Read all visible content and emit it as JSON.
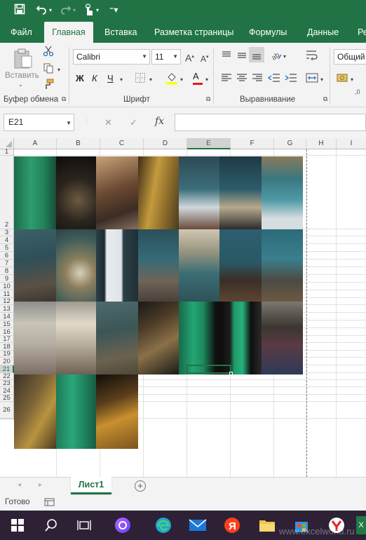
{
  "quick_access": {
    "save_icon": "save-icon",
    "undo_icon": "undo-icon",
    "redo_icon": "redo-icon",
    "touch_icon": "touch-mode-icon",
    "customize_icon": "customize-icon"
  },
  "tabs": [
    {
      "label": "Файл"
    },
    {
      "label": "Главная"
    },
    {
      "label": "Вставка"
    },
    {
      "label": "Разметка страницы"
    },
    {
      "label": "Формулы"
    },
    {
      "label": "Данные"
    },
    {
      "label": "Ре"
    }
  ],
  "ribbon": {
    "paste_label": "Вставить",
    "clipboard_group": "Буфер обмена",
    "font_name": "Calibri",
    "font_size": "11",
    "font_group": "Шрифт",
    "bold": "Ж",
    "italic": "К",
    "underline": "Ч",
    "grow_font": "A",
    "shrink_font": "A",
    "font_color_letter": "A",
    "alignment_group": "Выравнивание",
    "number_format": "Общий"
  },
  "formula_bar": {
    "name_box": "E21",
    "fx": "fx",
    "cancel": "✕",
    "enter": "✓",
    "formula": ""
  },
  "columns": [
    "A",
    "B",
    "C",
    "D",
    "E",
    "F",
    "G",
    "H",
    "I"
  ],
  "rows": [
    "1",
    "2",
    "3",
    "4",
    "5",
    "6",
    "7",
    "8",
    "9",
    "10",
    "11",
    "12",
    "13",
    "14",
    "15",
    "16",
    "17",
    "18",
    "19",
    "20",
    "21",
    "22",
    "23",
    "24",
    "25",
    "26"
  ],
  "selected_cell": "E21",
  "sheet_tabs": {
    "active": "Лист1",
    "add": "+"
  },
  "status": {
    "ready": "Готово"
  },
  "taskbar": {
    "watermark": "www.excelworld.ru"
  },
  "colors": {
    "excel_green": "#217346",
    "taskbar": "#2e2136"
  }
}
